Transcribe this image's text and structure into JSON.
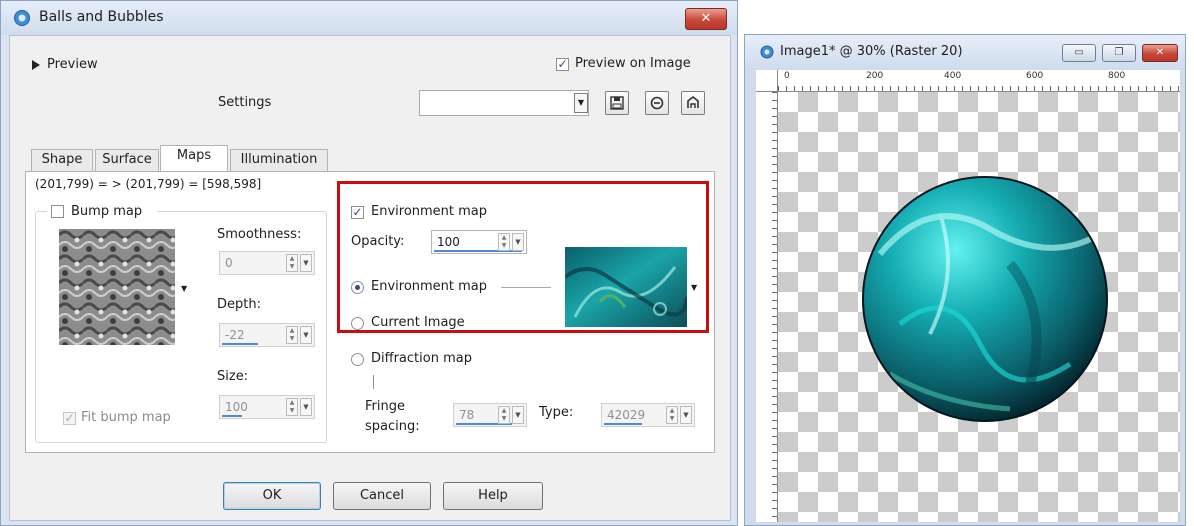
{
  "dialog": {
    "title": "Balls and Bubbles",
    "close_label": "✕",
    "preview_toggle_label": "Preview",
    "preview_on_image": {
      "label": "Preview on Image",
      "checked": true
    },
    "settings_label": "Settings",
    "settings_value": "",
    "tabs": [
      {
        "label": "Shape"
      },
      {
        "label": "Surface"
      },
      {
        "label": "Maps",
        "active": true
      },
      {
        "label": "Illumination"
      }
    ],
    "coords_text": "(201,799) = > (201,799) = [598,598]",
    "bump_map": {
      "checkbox_label": "Bump map",
      "checked": false,
      "smoothness_label": "Smoothness:",
      "smoothness_value": "0",
      "depth_label": "Depth:",
      "depth_value": "-22",
      "size_label": "Size:",
      "size_value": "100",
      "fit_label": "Fit bump map",
      "fit_checked": true
    },
    "environment": {
      "checkbox_label": "Environment map",
      "checked": true,
      "opacity_label": "Opacity:",
      "opacity_value": "100",
      "radio_env_label": "Environment map",
      "radio_current_label": "Current Image",
      "selected": "Environment map"
    },
    "diffraction": {
      "radio_label": "Diffraction map",
      "fringe_label_1": "Fringe",
      "fringe_label_2": "spacing:",
      "fringe_value": "78",
      "type_label": "Type:",
      "type_value": "42029"
    },
    "buttons": {
      "ok": "OK",
      "cancel": "Cancel",
      "help": "Help"
    }
  },
  "image_window": {
    "title": "Image1* @  30% (Raster 20)",
    "ruler_labels": [
      "0",
      "200",
      "400",
      "600",
      "800"
    ],
    "buttons": {
      "minimize": "▭",
      "restore": "❐",
      "close": "✕"
    }
  },
  "colors": {
    "highlight": "#cc0d0d",
    "sphere": "#0e8c96",
    "accent": "#4a8ad8"
  },
  "icons": [
    "app-logo-icon",
    "triangle-right-icon",
    "dropdown-arrow-icon",
    "save-icon",
    "delete-icon",
    "reset-icon"
  ]
}
